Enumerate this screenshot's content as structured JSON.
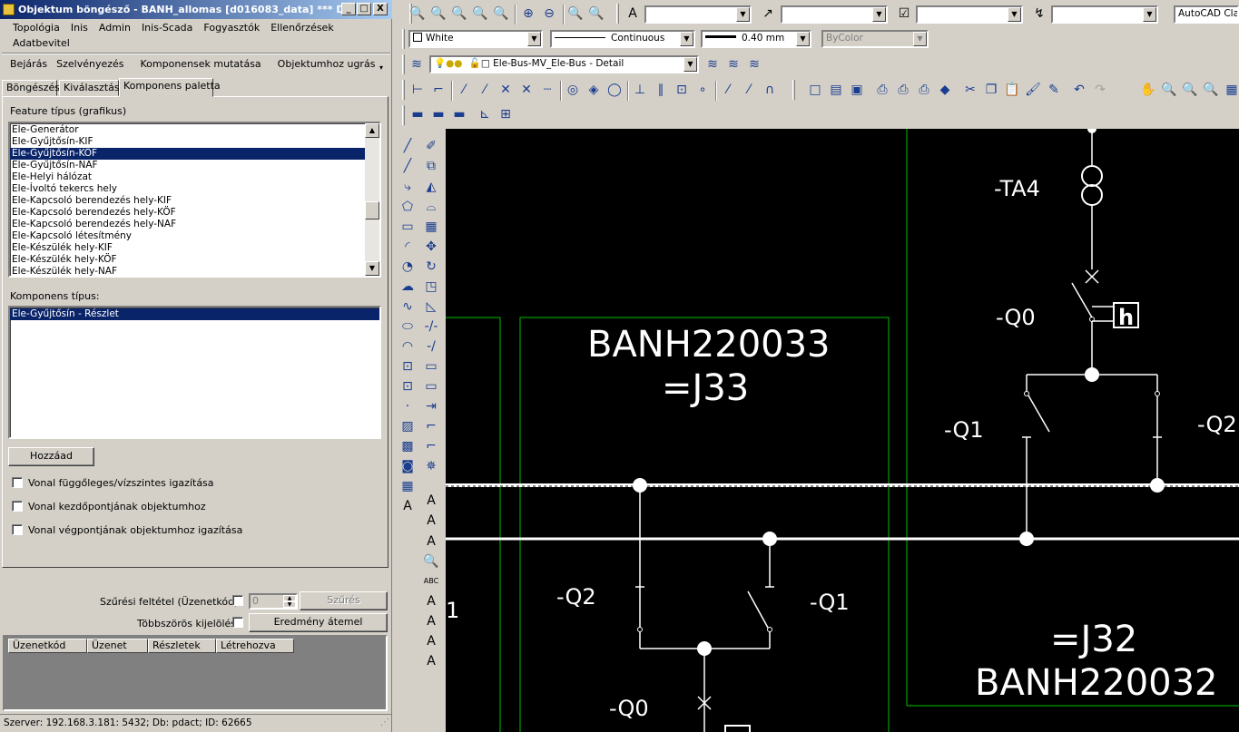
{
  "window": {
    "title": "Objektum böngésző - BANH_allomas [d016083_data] *** D...",
    "controls": [
      "_",
      "□",
      "X"
    ]
  },
  "menu": [
    "Topológia",
    "Inis",
    "Admin",
    "Inis-Scada",
    "Fogyasztók",
    "Ellenőrzések",
    "Adatbevitel"
  ],
  "links": [
    "Bejárás",
    "Szelvényezés",
    "Komponensek mutatása",
    "Objektumhoz ugrás"
  ],
  "tabs": [
    "Böngészés",
    "Kiválasztás",
    "Komponens paletta"
  ],
  "active_tab": "Komponens paletta",
  "feature": {
    "label": "Feature típus (grafikus)",
    "items": [
      "Ele-Generátor",
      "Ele-Gyűjtősín-KIF",
      "Ele-Gyűjtősín-KÖF",
      "Ele-Gyűjtősín-NAF",
      "Ele-Helyi hálózat",
      "Ele-Ívoltó tekercs hely",
      "Ele-Kapcsoló berendezés hely-KIF",
      "Ele-Kapcsoló berendezés hely-KÖF",
      "Ele-Kapcsoló berendezés hely-NAF",
      "Ele-Kapcsoló létesítmény",
      "Ele-Készülék hely-KIF",
      "Ele-Készülék hely-KÖF",
      "Ele-Készülék hely-NAF"
    ],
    "selected": "Ele-Gyűjtősín-KÖF"
  },
  "component": {
    "label": "Komponens típus:",
    "items": [
      "Ele-Gyűjtősín - Részlet"
    ],
    "selected": "Ele-Gyűjtősín - Részlet"
  },
  "add_button": "Hozzáad",
  "options": [
    "Vonal függőleges/vízszintes igazítása",
    "Vonal kezdőpontjának objektumhoz",
    "Vonal végpontjának objektumhoz igazítása"
  ],
  "filter": {
    "label": "Szűrési feltétel (Üzenetkód):",
    "value": "0",
    "button": "Szűrés"
  },
  "multi": {
    "label": "Többszörös kijelölés",
    "button": "Eredmény átemel"
  },
  "grid_columns": [
    "Üzenetkód",
    "Üzenet",
    "Részletek",
    "Létrehozva"
  ],
  "status": "Szerver: 192.168.3.181: 5432; Db: pdact; ID: 62665",
  "acad": {
    "workspace": "AutoCAD Cla",
    "color": "White",
    "linetype": "Continuous",
    "lineweight": "0.40 mm",
    "plotstyle": "ByColor",
    "layer": "Ele-Bus-MV_Ele-Bus - Detail"
  },
  "drawing": {
    "labels": {
      "ta4": "-TA4",
      "q0_top": "-Q0",
      "h": "h",
      "q1_right": "-Q1",
      "q2_right": "-Q2",
      "code_left": "BANH220033",
      "j33": "=J33",
      "q2_left": "-Q2",
      "q1_left": "-Q1",
      "q0_left": "-Q0",
      "j32": "=J32",
      "code_right": "BANH220032",
      "one": "1"
    }
  }
}
